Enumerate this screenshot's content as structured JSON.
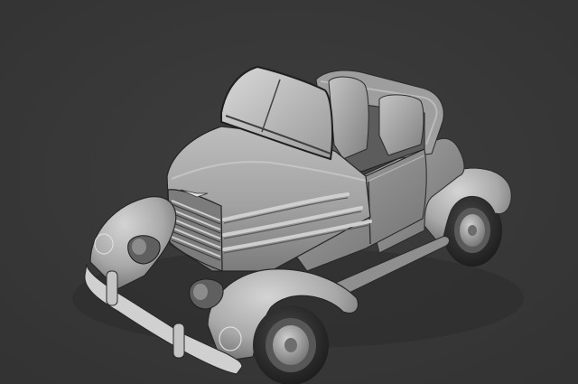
{
  "viewport": {
    "background": "#3a3a3a",
    "subject": "convertible-car-model"
  },
  "colors": {
    "clay_light": "#c9c9c9",
    "clay_mid": "#a3a3a3",
    "clay_dark": "#6e6e6e",
    "clay_shadow": "#4b4b4b",
    "tire": "#2c2c2c",
    "tire_rim": "#8d8d8d",
    "edge": "#202020"
  }
}
